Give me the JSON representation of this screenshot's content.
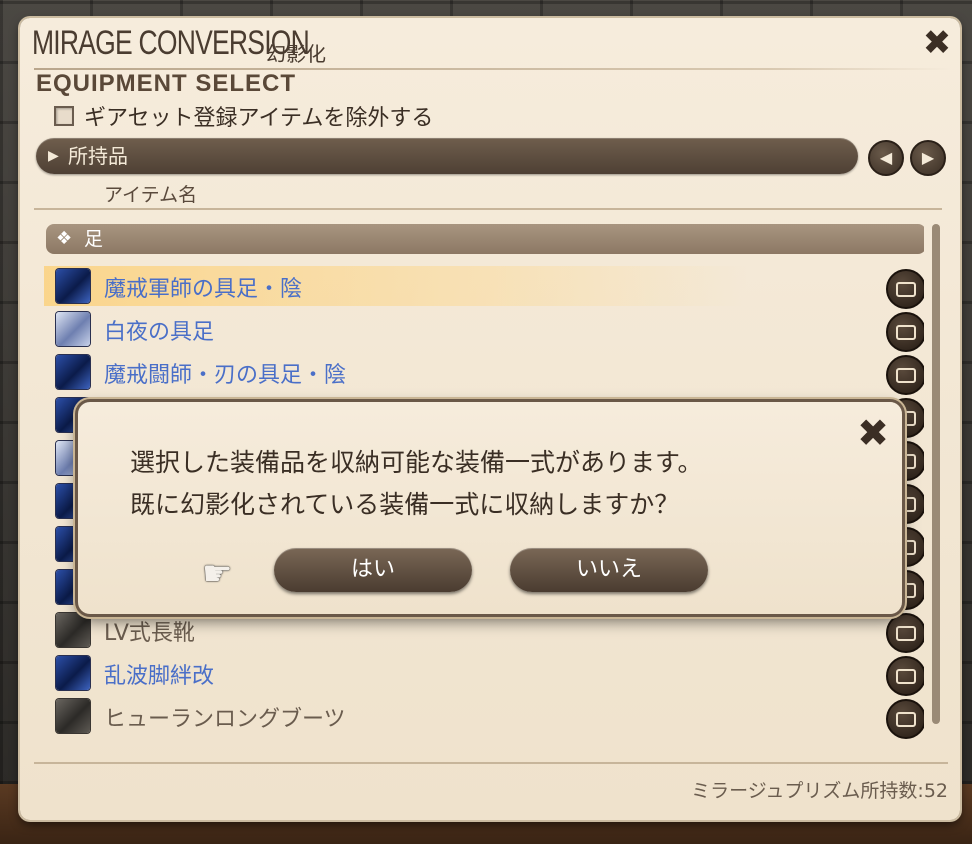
{
  "window": {
    "title": "MIRAGE CONVERSION",
    "title_jp": "幻影化",
    "close_icon": "✖",
    "subtitle": "EQUIPMENT SELECT",
    "exclude_label": "ギアセット登録アイテムを除外する"
  },
  "category": {
    "label": "所持品",
    "prev_icon": "◀",
    "next_icon": "▶"
  },
  "column_header": "アイテム名",
  "group": {
    "label": "足",
    "icon": "❖"
  },
  "items": [
    {
      "name": "魔戒軍師の具足・陰",
      "icon": "blue",
      "selected": true
    },
    {
      "name": "白夜の具足",
      "icon": "white"
    },
    {
      "name": "魔戒闘師・刃の具足・陰",
      "icon": "blue"
    },
    {
      "name": "",
      "icon": "blue"
    },
    {
      "name": "",
      "icon": "white"
    },
    {
      "name": "",
      "icon": "blue"
    },
    {
      "name": "",
      "icon": "blue"
    },
    {
      "name": "",
      "icon": "blue"
    },
    {
      "name": "LV式長靴",
      "icon": "gray",
      "gray": true
    },
    {
      "name": "乱波脚絆改",
      "icon": "blue"
    },
    {
      "name": "ヒューランロングブーツ",
      "icon": "gray",
      "gray": true
    }
  ],
  "footer": {
    "prism_count": "ミラージュプリズム所持数:52"
  },
  "dialog": {
    "line1": "選択した装備品を収納可能な装備一式があります。",
    "line2": "既に幻影化されている装備一式に収納しますか？",
    "yes": "はい",
    "no": "いいえ",
    "pointer_icon": "☛"
  },
  "colors": {
    "accent_link": "#4a6fc8",
    "panel": "#efe2cc",
    "button": "#4a3c30"
  }
}
